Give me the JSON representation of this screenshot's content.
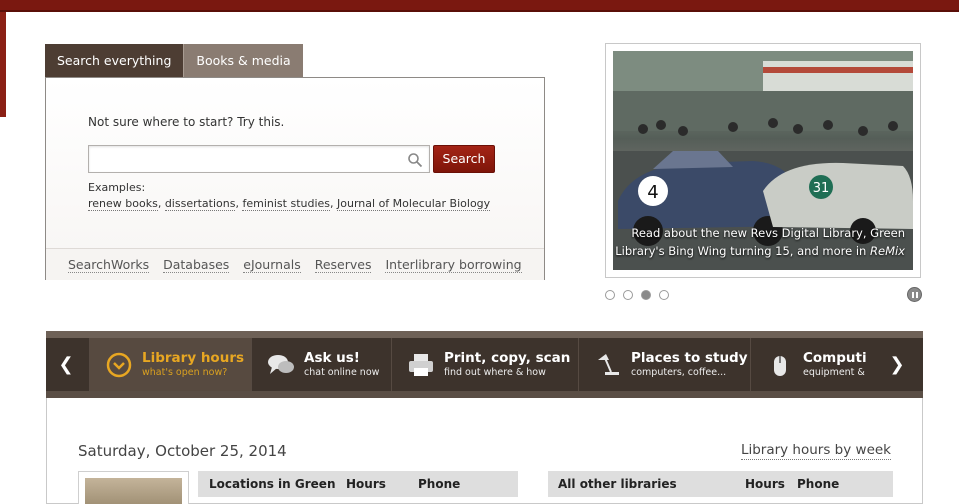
{
  "search": {
    "tabs": [
      {
        "label": "Search everything",
        "active": true
      },
      {
        "label": "Books & media",
        "active": false
      }
    ],
    "hint": "Not sure where to start? Try this.",
    "input_value": "",
    "button_label": "Search",
    "examples_label": "Examples:",
    "examples": [
      "renew books",
      "dissertations",
      "feminist studies",
      "Journal of Molecular Biology"
    ],
    "links": [
      "SearchWorks",
      "Databases",
      "eJournals",
      "Reserves",
      "Interlibrary borrowing"
    ]
  },
  "feature": {
    "caption_line1": "Read about the new Revs Digital Library, Green",
    "caption_line2_prefix": "Library's Bing Wing turning 15, and more in ",
    "caption_italic": "ReMix",
    "slide_count": 4,
    "active_slide": 3
  },
  "services": {
    "items": [
      {
        "title": "Library hours",
        "subtitle": "what's open now?",
        "icon": "clock-icon",
        "active": true
      },
      {
        "title": "Ask us!",
        "subtitle": "chat online now",
        "icon": "chat-bubbles-icon",
        "active": false
      },
      {
        "title": "Print, copy, scan",
        "subtitle": "find out where & how",
        "icon": "printer-icon",
        "active": false
      },
      {
        "title": "Places to study",
        "subtitle": "computers, coffee...",
        "icon": "desk-lamp-icon",
        "active": false
      },
      {
        "title": "Computi",
        "subtitle": "equipment &",
        "icon": "mouse-icon",
        "active": false
      }
    ]
  },
  "hours": {
    "date": "Saturday, October 25, 2014",
    "by_week_link": "Library hours by week",
    "green_table": {
      "columns": [
        "Locations in Green",
        "Hours",
        "Phone"
      ]
    },
    "other_table": {
      "columns": [
        "All other libraries",
        "Hours",
        "Phone"
      ]
    }
  },
  "colors": {
    "brand_red": "#8c1515",
    "tab_active": "#4d3d33",
    "tab_inactive": "#8a7c72",
    "bar_dark": "#3d332c",
    "accent_gold": "#e8a722"
  }
}
